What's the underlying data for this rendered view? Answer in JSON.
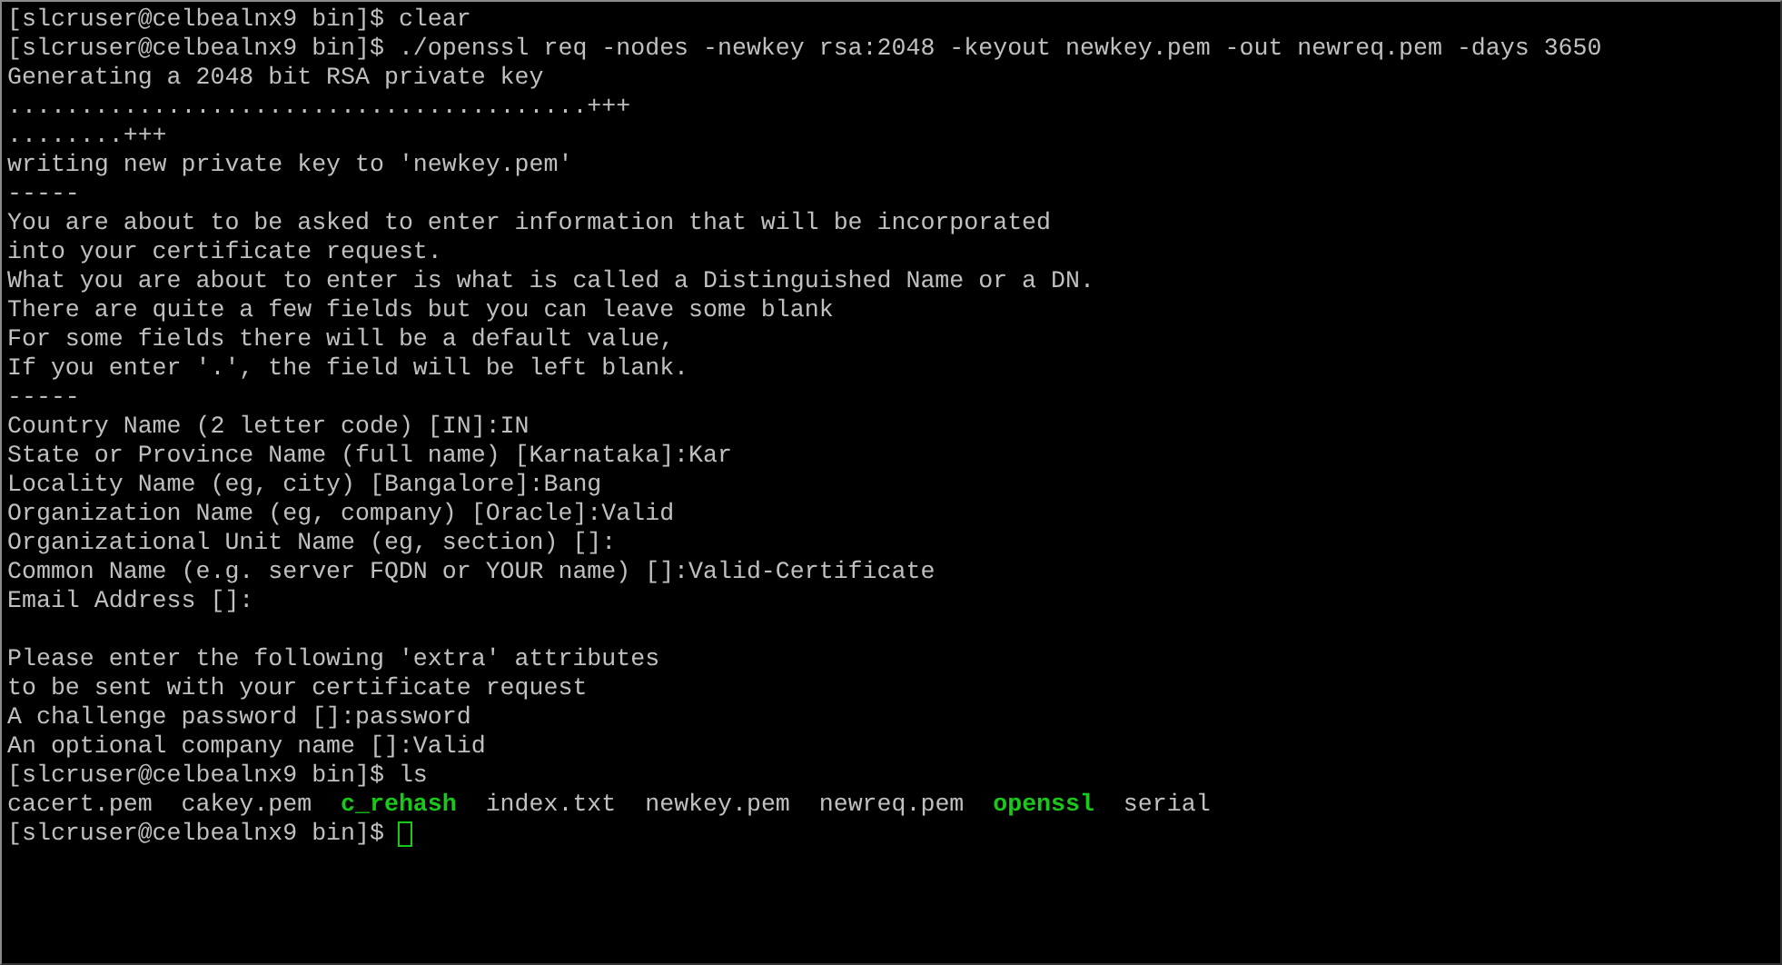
{
  "lines": [
    {
      "kind": "text",
      "text": "[slcruser@celbealnx9 bin]$ clear"
    },
    {
      "kind": "text",
      "text": "[slcruser@celbealnx9 bin]$ ./openssl req -nodes -newkey rsa:2048 -keyout newkey.pem -out newreq.pem -days 3650"
    },
    {
      "kind": "text",
      "text": "Generating a 2048 bit RSA private key"
    },
    {
      "kind": "text",
      "text": "........................................+++"
    },
    {
      "kind": "text",
      "text": "........+++"
    },
    {
      "kind": "text",
      "text": "writing new private key to 'newkey.pem'"
    },
    {
      "kind": "text",
      "text": "-----"
    },
    {
      "kind": "text",
      "text": "You are about to be asked to enter information that will be incorporated"
    },
    {
      "kind": "text",
      "text": "into your certificate request."
    },
    {
      "kind": "text",
      "text": "What you are about to enter is what is called a Distinguished Name or a DN."
    },
    {
      "kind": "text",
      "text": "There are quite a few fields but you can leave some blank"
    },
    {
      "kind": "text",
      "text": "For some fields there will be a default value,"
    },
    {
      "kind": "text",
      "text": "If you enter '.', the field will be left blank."
    },
    {
      "kind": "text",
      "text": "-----"
    },
    {
      "kind": "text",
      "text": "Country Name (2 letter code) [IN]:IN"
    },
    {
      "kind": "text",
      "text": "State or Province Name (full name) [Karnataka]:Kar"
    },
    {
      "kind": "text",
      "text": "Locality Name (eg, city) [Bangalore]:Bang"
    },
    {
      "kind": "text",
      "text": "Organization Name (eg, company) [Oracle]:Valid"
    },
    {
      "kind": "text",
      "text": "Organizational Unit Name (eg, section) []:"
    },
    {
      "kind": "text",
      "text": "Common Name (e.g. server FQDN or YOUR name) []:Valid-Certificate"
    },
    {
      "kind": "text",
      "text": "Email Address []:"
    },
    {
      "kind": "blank"
    },
    {
      "kind": "text",
      "text": "Please enter the following 'extra' attributes"
    },
    {
      "kind": "text",
      "text": "to be sent with your certificate request"
    },
    {
      "kind": "text",
      "text": "A challenge password []:password"
    },
    {
      "kind": "text",
      "text": "An optional company name []:Valid"
    },
    {
      "kind": "text",
      "text": "[slcruser@celbealnx9 bin]$ ls"
    },
    {
      "kind": "files",
      "files": [
        {
          "name": "cacert.pem",
          "executable": false
        },
        {
          "name": "cakey.pem",
          "executable": false
        },
        {
          "name": "c_rehash",
          "executable": true
        },
        {
          "name": "index.txt",
          "executable": false
        },
        {
          "name": "newkey.pem",
          "executable": false
        },
        {
          "name": "newreq.pem",
          "executable": false
        },
        {
          "name": "openssl",
          "executable": true
        },
        {
          "name": "serial",
          "executable": false
        }
      ]
    },
    {
      "kind": "cursor",
      "text": "[slcruser@celbealnx9 bin]$"
    }
  ]
}
